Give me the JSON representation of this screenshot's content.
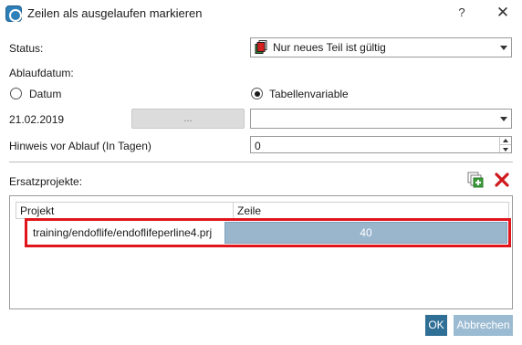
{
  "window": {
    "title": "Zeilen als ausgelaufen markieren",
    "help_label": "?",
    "close_label": "✕"
  },
  "status": {
    "label": "Status:",
    "value": "Nur neues Teil ist gültig",
    "icon": "status-part-icon"
  },
  "expiry": {
    "label": "Ablaufdatum:",
    "option_date": "Datum",
    "option_table_variable": "Tabellenvariable",
    "selected": "Tabellenvariable",
    "date_value": "21.02.2019",
    "date_button_label": "...",
    "table_variable_value": ""
  },
  "notice": {
    "label": "Hinweis vor Ablauf (In Tagen)",
    "value": "0"
  },
  "replacement": {
    "label": "Ersatzprojekte:",
    "add_icon": "add-project-icon",
    "delete_icon": "delete-icon",
    "columns": [
      "Projekt",
      "Zeile"
    ],
    "rows": [
      {
        "project": "training/endoflife/endoflifeperline4.prj",
        "line": "40"
      }
    ]
  },
  "buttons": {
    "ok": "OK",
    "cancel": "Abbrechen"
  },
  "colors": {
    "highlight_border": "#e0161c",
    "selected_cell": "#9ab6cd",
    "ok_button": "#2f6f96",
    "cancel_button": "#9bbbd2"
  }
}
